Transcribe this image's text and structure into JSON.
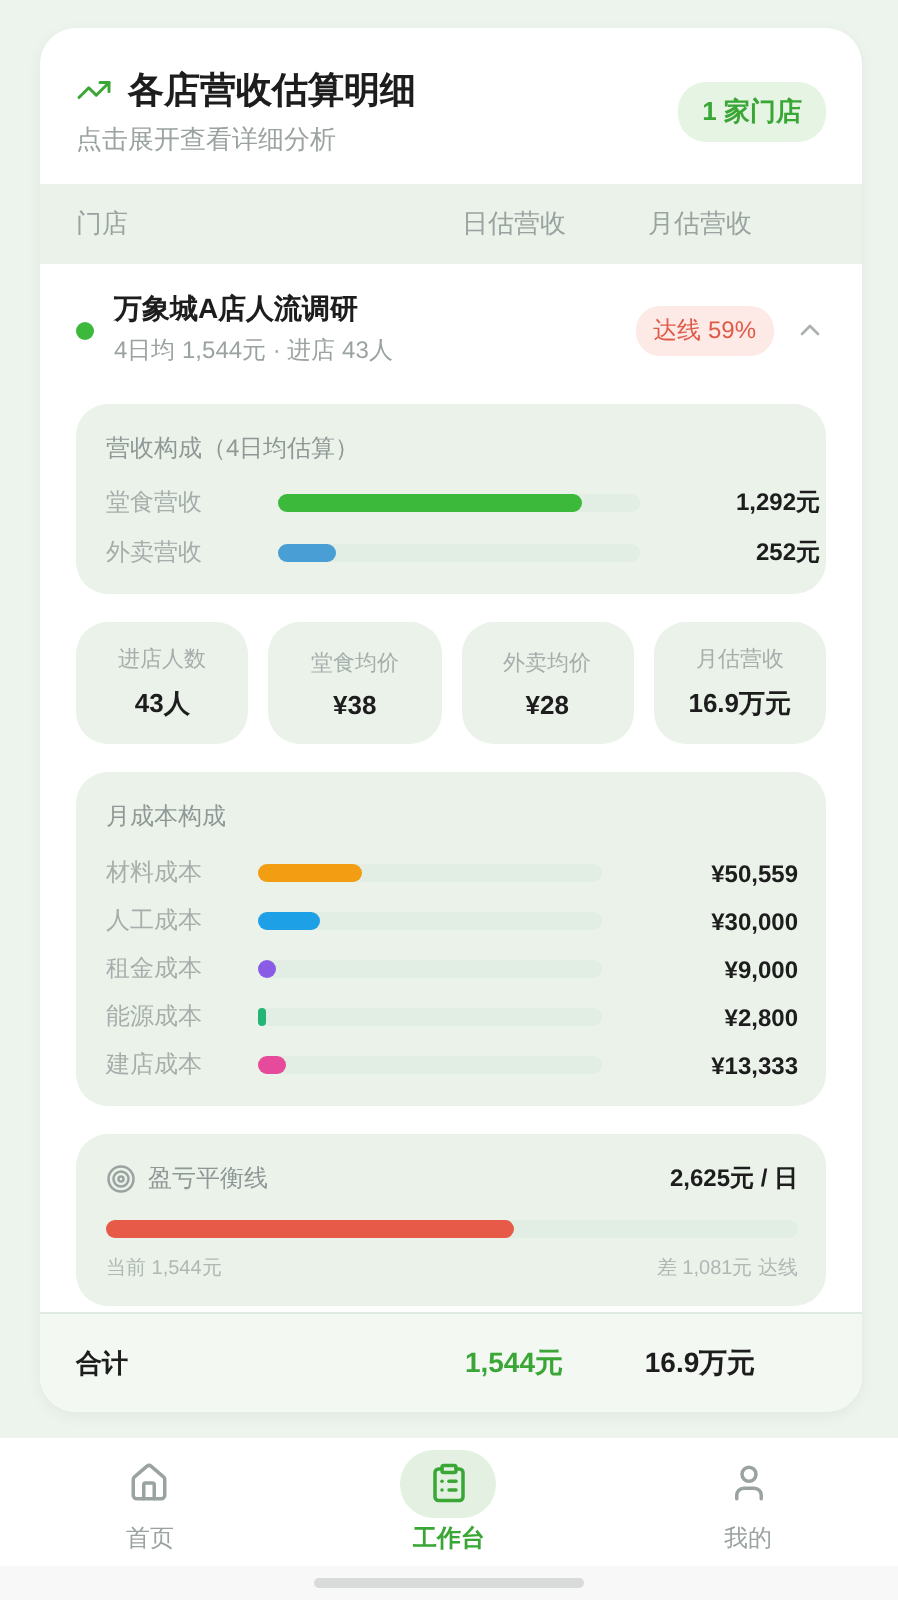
{
  "header": {
    "title": "各店营收估算明细",
    "subtitle": "点击展开查看详细分析",
    "badge": "1 家门店"
  },
  "table": {
    "columns": [
      "门店",
      "日估营收",
      "月估营收"
    ]
  },
  "store": {
    "name": "万象城A店人流调研",
    "meta": "4日均 1,544元 · 进店 43人",
    "tag": "达线 59%",
    "expanded": true
  },
  "revenue": {
    "title": "营收构成（4日均估算）",
    "rows": [
      {
        "label": "堂食营收",
        "value": "1,292元",
        "level": 0.84,
        "color": "#3cb83a"
      },
      {
        "label": "外卖营收",
        "value": "252元",
        "level": 0.16,
        "color": "#4a9ed6"
      }
    ]
  },
  "stats": [
    {
      "label": "进店人数",
      "value": "43人"
    },
    {
      "label": "堂食均价",
      "value": "¥38"
    },
    {
      "label": "外卖均价",
      "value": "¥28"
    },
    {
      "label": "月估营收",
      "value": "16.9万元"
    }
  ],
  "costs": {
    "title": "月成本构成",
    "rows": [
      {
        "label": "材料成本",
        "value": "¥50,559",
        "level": 0.3,
        "color": "#f29d12"
      },
      {
        "label": "人工成本",
        "value": "¥30,000",
        "level": 0.18,
        "color": "#1ea0e6"
      },
      {
        "label": "租金成本",
        "value": "¥9,000",
        "level": 0.05,
        "color": "#8a5ce6"
      },
      {
        "label": "能源成本",
        "value": "¥2,800",
        "level": 0.02,
        "color": "#22b573"
      },
      {
        "label": "建店成本",
        "value": "¥13,333",
        "level": 0.08,
        "color": "#e64a9b"
      }
    ]
  },
  "breakeven": {
    "title": "盈亏平衡线",
    "target": "2,625元 / 日",
    "level": 0.59,
    "current": "当前 1,544元",
    "gap": "差 1,081元 达线"
  },
  "totals": {
    "label": "合计",
    "daily": "1,544元",
    "monthly": "16.9万元"
  },
  "nav": [
    {
      "label": "首页",
      "selected": false
    },
    {
      "label": "工作台",
      "selected": true
    },
    {
      "label": "我的",
      "selected": false
    }
  ]
}
